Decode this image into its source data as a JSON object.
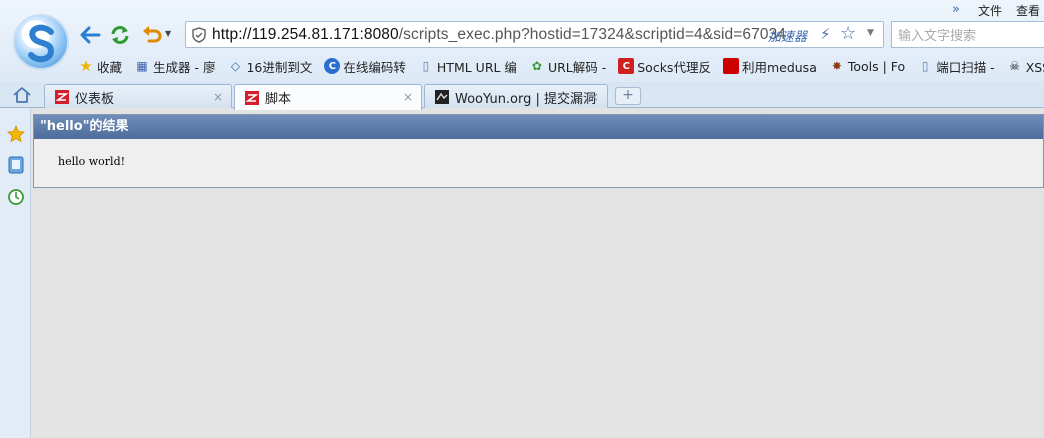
{
  "topmenu": {
    "expand": "»",
    "file": "文件",
    "view": "查看"
  },
  "toolbar": {
    "url_host": "http://119.254.81.171:8080",
    "url_path": "/scripts_exec.php?hostid=17324&scriptid=4&sid=67034",
    "accelerator": "加速器",
    "search_placeholder": "输入文字搜索"
  },
  "bookmarks": [
    {
      "label": "收藏",
      "icon": "star-icon"
    },
    {
      "label": "生成器 - 廖",
      "icon": "film-icon"
    },
    {
      "label": "16进制到文",
      "icon": "code-icon"
    },
    {
      "label": "在线编码转",
      "icon": "c-logo-icon"
    },
    {
      "label": "HTML URL 编",
      "icon": "page-icon"
    },
    {
      "label": "URL解码 -",
      "icon": "puzzle-icon"
    },
    {
      "label": "Socks代理反",
      "icon": "red-c-icon"
    },
    {
      "label": "利用medusa",
      "icon": "redhat-icon"
    },
    {
      "label": "Tools | Fo",
      "icon": "bug-icon"
    },
    {
      "label": "端口扫描 -",
      "icon": "page-icon"
    },
    {
      "label": "XSS平台",
      "icon": "skull-icon"
    }
  ],
  "tabs": [
    {
      "label": "仪表板",
      "icon": "zabbix-icon"
    },
    {
      "label": "脚本",
      "icon": "zabbix-icon"
    },
    {
      "label": "WooYun.org | 提交漏洞",
      "icon": "wooyun-icon"
    }
  ],
  "tab_close": "×",
  "new_tab": "+",
  "panel": {
    "title": "\"hello\"的结果",
    "output": "hello world!"
  },
  "colors": {
    "panel_header": "#5b7aa8",
    "accent_blue": "#3a6ab0",
    "refresh_green": "#2e9b2e",
    "undo_orange": "#e08a00"
  }
}
